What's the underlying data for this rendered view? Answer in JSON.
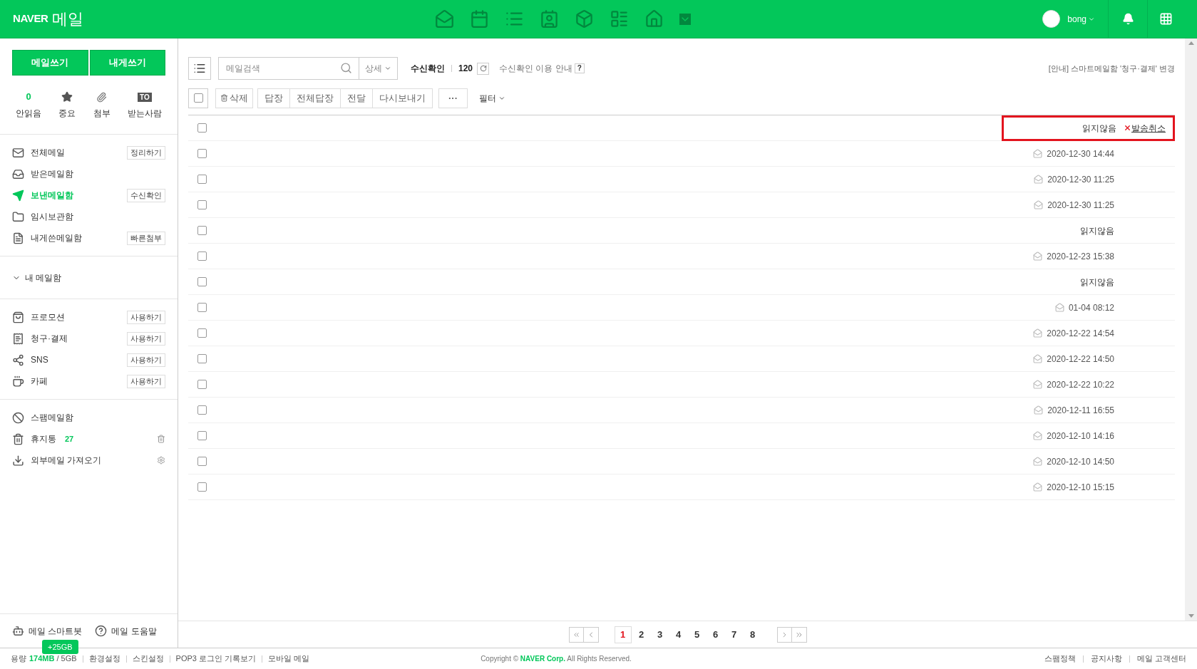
{
  "header": {
    "brand": "NAVER",
    "title": "메일",
    "user": "bong"
  },
  "sidebar": {
    "compose": [
      "메일쓰기",
      "내게쓰기"
    ],
    "quick": [
      {
        "kind": "count",
        "value": "0",
        "label": "안읽음"
      },
      {
        "kind": "star",
        "label": "중요"
      },
      {
        "kind": "clip",
        "label": "첨부"
      },
      {
        "kind": "to",
        "badge": "TO",
        "label": "받는사람"
      }
    ],
    "folders": [
      {
        "kind": "mail",
        "label": "전체메일",
        "button": "정리하기",
        "selected": false
      },
      {
        "kind": "inbox",
        "label": "받은메일함",
        "selected": false
      },
      {
        "kind": "send",
        "label": "보낸메일함",
        "button": "수신확인",
        "selected": true
      },
      {
        "kind": "folder",
        "label": "임시보관함",
        "selected": false
      },
      {
        "kind": "note",
        "label": "내게쓴메일함",
        "button": "빠른첨부",
        "selected": false
      }
    ],
    "my_mailbox": {
      "label": "내 메일함",
      "expanded": false
    },
    "smart": [
      {
        "kind": "bag",
        "label": "프로모션",
        "button": "사용하기"
      },
      {
        "kind": "bill",
        "label": "청구·결제",
        "button": "사용하기"
      },
      {
        "kind": "share",
        "label": "SNS",
        "button": "사용하기"
      },
      {
        "kind": "cup",
        "label": "카페",
        "button": "사용하기"
      }
    ],
    "other": [
      {
        "kind": "ban",
        "label": "스팸메일함"
      },
      {
        "kind": "trash",
        "label": "휴지통",
        "count": "27"
      },
      {
        "kind": "import",
        "label": "외부메일 가져오기"
      }
    ],
    "bottom": [
      {
        "kind": "bot",
        "label": "메일 스마트봇"
      },
      {
        "kind": "help",
        "label": "메일 도움말"
      }
    ],
    "storage_badge": "+25GB"
  },
  "toolbar": {
    "search_placeholder": "메일검색",
    "detail": "상세",
    "receipt_label": "수신확인",
    "receipt_count": "120",
    "receipt_help": "수신확인 이용 안내",
    "help_mark": "?",
    "notice": "[안내] 스마트메일함 '청구·결제' 변경",
    "select_all": false,
    "delete": "삭제",
    "actions": [
      "답장",
      "전체답장",
      "전달",
      "다시보내기"
    ],
    "more": "···",
    "filter": "필터"
  },
  "rows": [
    {
      "checked": false,
      "kind": "unread",
      "status": "읽지않음",
      "cancel": "발송취소",
      "highlighted": true
    },
    {
      "checked": false,
      "kind": "read",
      "status": "2020-12-30 14:44",
      "highlighted": false
    },
    {
      "checked": false,
      "kind": "read",
      "status": "2020-12-30 11:25",
      "highlighted": false
    },
    {
      "checked": false,
      "kind": "read",
      "status": "2020-12-30 11:25",
      "highlighted": false
    },
    {
      "checked": false,
      "kind": "unread",
      "status": "읽지않음",
      "highlighted": false
    },
    {
      "checked": false,
      "kind": "read",
      "status": "2020-12-23 15:38",
      "highlighted": false
    },
    {
      "checked": false,
      "kind": "unread",
      "status": "읽지않음",
      "highlighted": false
    },
    {
      "checked": false,
      "kind": "read",
      "status": "01-04 08:12",
      "highlighted": false
    },
    {
      "checked": false,
      "kind": "read",
      "status": "2020-12-22 14:54",
      "highlighted": false
    },
    {
      "checked": false,
      "kind": "read",
      "status": "2020-12-22 14:50",
      "highlighted": false
    },
    {
      "checked": false,
      "kind": "read",
      "status": "2020-12-22 10:22",
      "highlighted": false
    },
    {
      "checked": false,
      "kind": "read",
      "status": "2020-12-11 16:55",
      "highlighted": false
    },
    {
      "checked": false,
      "kind": "read",
      "status": "2020-12-10 14:16",
      "highlighted": false
    },
    {
      "checked": false,
      "kind": "read",
      "status": "2020-12-10 14:50",
      "highlighted": false
    },
    {
      "checked": false,
      "kind": "read",
      "status": "2020-12-10 15:15",
      "highlighted": false
    }
  ],
  "pagination": [
    {
      "label": "1",
      "selected": true
    },
    {
      "label": "2",
      "selected": false
    },
    {
      "label": "3",
      "selected": false
    },
    {
      "label": "4",
      "selected": false
    },
    {
      "label": "5",
      "selected": false
    },
    {
      "label": "6",
      "selected": false
    },
    {
      "label": "7",
      "selected": false
    },
    {
      "label": "8",
      "selected": false
    }
  ],
  "footer": {
    "storage": {
      "label": "용량",
      "used": "174MB",
      "total": "/ 5GB"
    },
    "links": [
      "환경설정",
      "스킨설정",
      "POP3 로그인 기록보기",
      "모바일 메일"
    ],
    "copyright": "Copyright © **NAVER Corp.** All Rights Reserved.",
    "right_links": [
      "스팸정책",
      "공지사항",
      "메일 고객센터"
    ]
  }
}
